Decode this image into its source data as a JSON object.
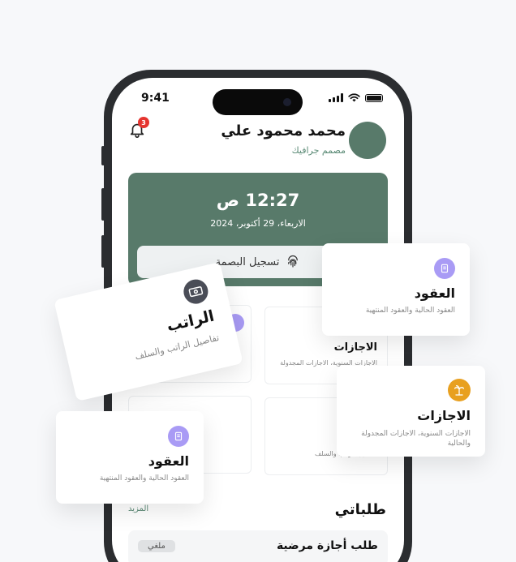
{
  "status_bar": {
    "time": "9:41"
  },
  "notifications": {
    "count": "3"
  },
  "user": {
    "name": "محمد محمود علي",
    "role": "مصمم جرافيك"
  },
  "attendance": {
    "time": "12:27 ص",
    "date": "الاربعاء، 29 أكتوبر، 2024",
    "checkin_label": "تسجيل البصمة"
  },
  "cards": {
    "leaves": {
      "title": "الاجازات",
      "subtitle": "الاجازات السنوية، الاجازات المجدولة"
    },
    "salary_sub": "تفاصيل الراتب والسلف"
  },
  "floating": {
    "contracts_top": {
      "title": "العقود",
      "subtitle": "العقود الحالية والعقود المنتهية"
    },
    "salary": {
      "title": "الراتب",
      "subtitle": "تفاصيل الراتب والسلف"
    },
    "leaves": {
      "title": "الاجازات",
      "subtitle": "الاجازات السنوية، الاجازات المجدولة والحالية"
    },
    "contracts_bottom": {
      "title": "العقود",
      "subtitle": "العقود الحالية والعقود المنتهية"
    }
  },
  "requests": {
    "title": "طلباتي",
    "more_label": "المزيد",
    "items": [
      {
        "title": "طلب أجازة مرضية",
        "status": "ملغي"
      }
    ]
  },
  "colors": {
    "primary": "#587a6a",
    "purple": "#a99bf5",
    "orange": "#e8a020",
    "badge": "#e5342f"
  }
}
